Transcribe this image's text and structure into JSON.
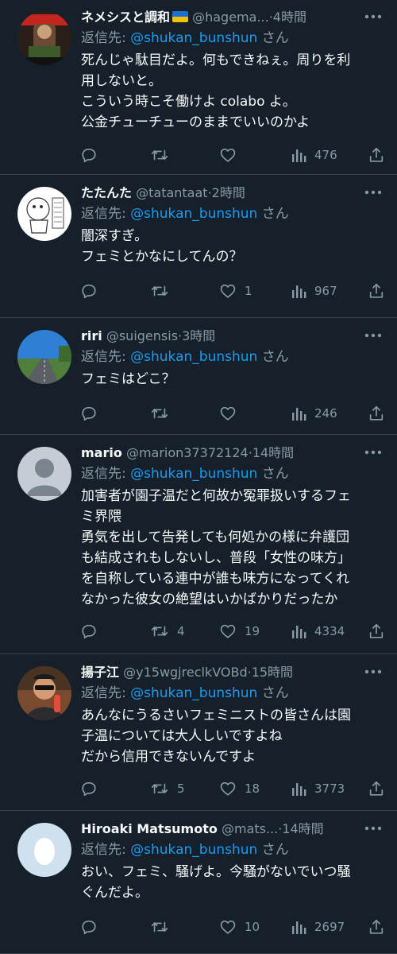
{
  "colors": {
    "background": "#15202b",
    "divider": "#38444d",
    "text": "#f7f9f9",
    "muted": "#8b98a5",
    "link": "#1d9bf0"
  },
  "reply_prefix": "返信先:",
  "reply_suffix": "さん",
  "tweets": [
    {
      "name": "ネメシスと調和",
      "has_flag_icon": true,
      "handle": "@hagema...",
      "time": "4時間",
      "reply_to": "@shukan_bunshun",
      "lines": [
        "死んじゃ駄目だよ。何もできねぇ。周りを利",
        "用しないと。",
        "こういう時こそ働けよ colabo よ。",
        "公金チューチューのままでいいのかよ"
      ],
      "replies": "",
      "retweets": "",
      "likes": "",
      "views": "476"
    },
    {
      "name": "たたんた",
      "has_flag_icon": false,
      "handle": "@tatantaat",
      "time": "2時間",
      "reply_to": "@shukan_bunshun",
      "lines": [
        "闇深すぎ。",
        "フェミとかなにしてんの？"
      ],
      "replies": "",
      "retweets": "",
      "likes": "1",
      "views": "967"
    },
    {
      "name": "riri",
      "has_flag_icon": false,
      "handle": "@suigensis",
      "time": "3時間",
      "reply_to": "@shukan_bunshun",
      "lines": [
        "フェミはどこ？"
      ],
      "replies": "",
      "retweets": "",
      "likes": "",
      "views": "246"
    },
    {
      "name": "mario",
      "has_flag_icon": false,
      "handle": "@marion37372124",
      "time": "14時間",
      "reply_to": "@shukan_bunshun",
      "lines": [
        "加害者が園子温だと何故か冤罪扱いするフェ",
        "ミ界隈",
        "勇気を出して告発しても何処かの様に弁護団",
        "も結成されもしないし、普段「女性の味方」",
        "を自称している連中が誰も味方になってくれ",
        "なかった彼女の絶望はいかばかりだったか"
      ],
      "replies": "",
      "retweets": "4",
      "likes": "19",
      "views": "4334"
    },
    {
      "name": "揚子江",
      "has_flag_icon": false,
      "handle": "@y15wgjreclkVOBd",
      "time": "15時間",
      "reply_to": "@shukan_bunshun",
      "lines": [
        "あんなにうるさいフェミニストの皆さんは園",
        "子温については大人しいですよね",
        "だから信用できないんですよ"
      ],
      "replies": "",
      "retweets": "5",
      "likes": "18",
      "views": "3773"
    },
    {
      "name": "Hiroaki Matsumoto",
      "has_flag_icon": false,
      "handle": "@mats...",
      "time": "14時間",
      "reply_to": "@shukan_bunshun",
      "lines": [
        "おい、フェミ、騒げよ。今騒がないでいつ騒",
        "ぐんだよ。"
      ],
      "replies": "",
      "retweets": "",
      "likes": "10",
      "views": "2697"
    }
  ]
}
